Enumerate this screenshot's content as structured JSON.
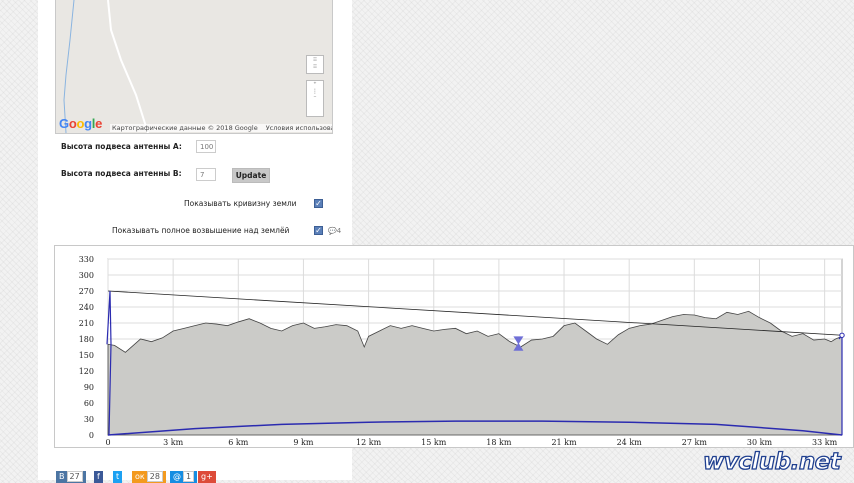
{
  "map": {
    "logo": {
      "G": "G",
      "o1": "o",
      "o2": "o",
      "g": "g",
      "l": "l",
      "e": "e"
    },
    "logo_colors": {
      "blue": "#4285f4",
      "red": "#ea4335",
      "yellow": "#fbbc05",
      "green": "#34a853"
    },
    "data_credit": "Картографические данные © 2018 Google",
    "terms_link": "Условия использования"
  },
  "form": {
    "height_a_label": "Высота подвеса антенны A:",
    "height_a_value": "100",
    "height_b_label": "Высота подвеса антенны B:",
    "height_b_value": "7",
    "update_label": "Update",
    "earth_curvature_label": "Показывать кривизну земли",
    "earth_curvature_checked": true,
    "full_elevation_label": "Показывать полное возвышение над землёй",
    "full_elevation_checked": true,
    "comments_count": "4"
  },
  "chart_data": {
    "type": "area",
    "x_unit": "km",
    "x_tick_labels": [
      "0",
      "3 km",
      "6 km",
      "9 km",
      "12 km",
      "15 km",
      "18 km",
      "21 km",
      "24 km",
      "27 km",
      "30 km",
      "33 km"
    ],
    "x_ticks": [
      0,
      3,
      6,
      9,
      12,
      15,
      18,
      21,
      24,
      27,
      30,
      33
    ],
    "y_tick_labels": [
      "0",
      "30",
      "60",
      "90",
      "120",
      "150",
      "180",
      "210",
      "240",
      "270",
      "300",
      "330"
    ],
    "y_ticks": [
      0,
      30,
      60,
      90,
      120,
      150,
      180,
      210,
      240,
      270,
      300,
      330
    ],
    "xlim": [
      0,
      33.8
    ],
    "ylim": [
      0,
      330
    ],
    "grid": true,
    "series": [
      {
        "role": "terrain",
        "color": "#cbcbc8",
        "x": [
          0,
          0.3,
          0.8,
          1.5,
          2,
          2.5,
          3,
          3.5,
          4,
          4.5,
          5,
          5.5,
          6,
          6.5,
          7,
          7.5,
          8,
          8.5,
          9,
          9.5,
          10,
          10.5,
          11,
          11.5,
          11.8,
          12,
          12.5,
          13,
          13.5,
          14,
          14.5,
          15,
          15.5,
          16,
          16.5,
          17,
          17.5,
          18,
          18.5,
          19,
          19.5,
          20,
          20.5,
          21,
          21.5,
          22,
          22.5,
          23,
          23.5,
          24,
          24.5,
          25,
          25.5,
          26,
          26.5,
          27,
          27.5,
          28,
          28.5,
          29,
          29.5,
          30,
          30.5,
          31,
          31.5,
          32,
          32.5,
          33,
          33.3,
          33.5,
          33.8
        ],
        "y": [
          170,
          168,
          155,
          180,
          175,
          182,
          195,
          200,
          205,
          210,
          208,
          205,
          212,
          218,
          210,
          200,
          195,
          205,
          210,
          200,
          203,
          207,
          205,
          195,
          165,
          185,
          195,
          205,
          200,
          205,
          200,
          195,
          198,
          200,
          190,
          195,
          185,
          190,
          175,
          165,
          178,
          180,
          185,
          205,
          210,
          195,
          180,
          170,
          188,
          200,
          205,
          208,
          215,
          222,
          226,
          225,
          220,
          218,
          230,
          226,
          232,
          220,
          210,
          195,
          185,
          190,
          178,
          180,
          175,
          180,
          185
        ]
      },
      {
        "role": "line_of_sight",
        "color": "#222222",
        "x": [
          0,
          33.8
        ],
        "y": [
          270,
          187
        ]
      },
      {
        "role": "earth_curvature",
        "color": "#2b2bb0",
        "x": [
          0,
          4,
          8,
          12,
          16,
          18,
          20,
          24,
          28,
          32,
          33.8
        ],
        "y": [
          0,
          12,
          20,
          24,
          26,
          26,
          26,
          24,
          20,
          8,
          0
        ]
      }
    ],
    "antenna_a": {
      "x": 0,
      "ground": 170,
      "top": 270
    },
    "antenna_b": {
      "x": 33.8,
      "ground": 180,
      "top": 187
    },
    "obstacle_marker": {
      "x": 18.9,
      "low": 158,
      "high": 185
    }
  },
  "social": [
    {
      "name": "vk",
      "label": "В",
      "count": "27",
      "color": "#4c75a3"
    },
    {
      "name": "facebook",
      "label": "f",
      "count": "",
      "color": "#3b5998"
    },
    {
      "name": "twitter",
      "label": "t",
      "count": "",
      "color": "#1da1f2"
    },
    {
      "name": "odnoklassniki",
      "label": "ок",
      "count": "28",
      "color": "#f39a1f"
    },
    {
      "name": "mailru",
      "label": "@",
      "count": "1",
      "color": "#168de2"
    },
    {
      "name": "googleplus",
      "label": "g+",
      "count": "",
      "color": "#dd4b39"
    }
  ],
  "watermark": "wvclub.net"
}
